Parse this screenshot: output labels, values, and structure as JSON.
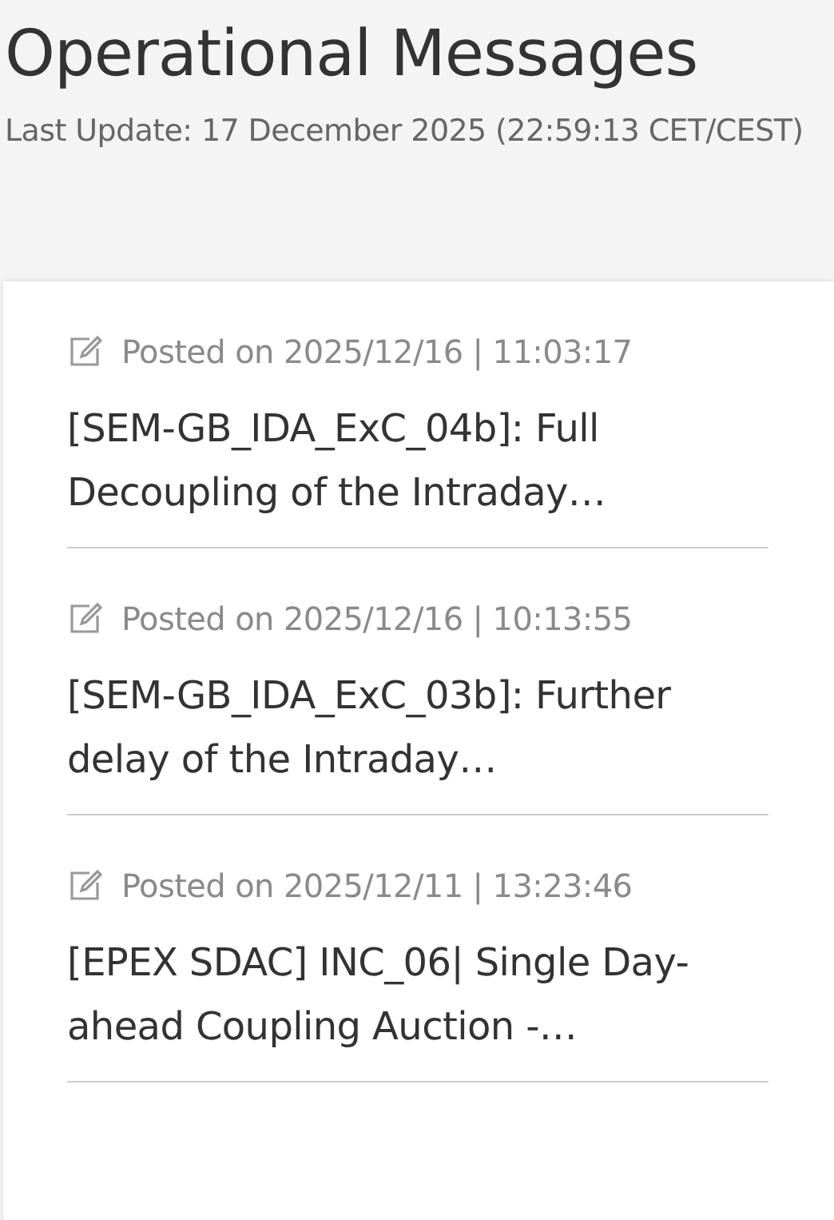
{
  "title": "Operational Messages",
  "last_update": "Last Update: 17 December 2025 (22:59:13 CET/CEST)",
  "messages": [
    {
      "posted": "Posted on 2025/12/16 | 11:03:17",
      "headline": "[SEM-GB_IDA_ExC_04b]: Full Decoupling of the Intraday…"
    },
    {
      "posted": "Posted on 2025/12/16 | 10:13:55",
      "headline": "[SEM-GB_IDA_ExC_03b]: Further delay of the Intraday…"
    },
    {
      "posted": "Posted on 2025/12/11 | 13:23:46",
      "headline": "[EPEX SDAC] INC_06| Single Day-ahead Coupling Auction -…"
    }
  ]
}
